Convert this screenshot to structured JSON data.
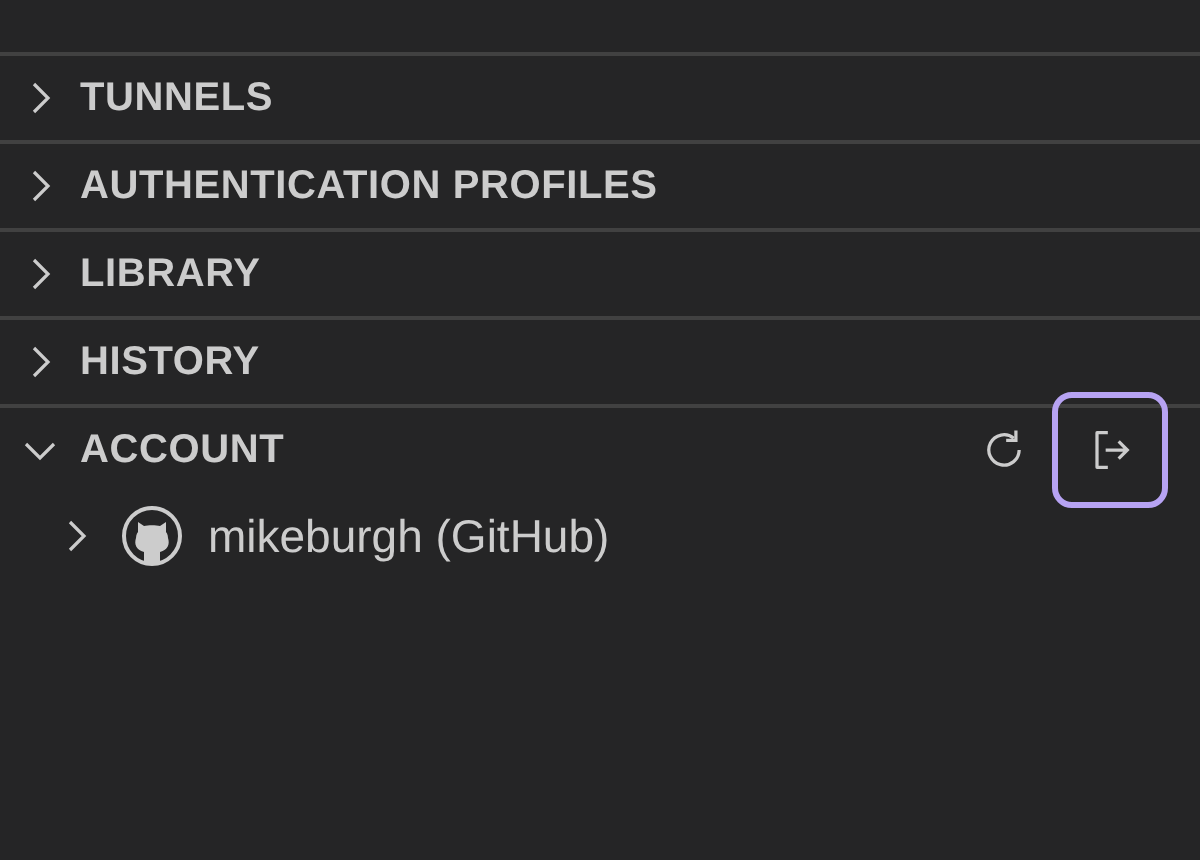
{
  "sections": [
    {
      "title": "TUNNELS",
      "expanded": false
    },
    {
      "title": "AUTHENTICATION PROFILES",
      "expanded": false
    },
    {
      "title": "LIBRARY",
      "expanded": false
    },
    {
      "title": "HISTORY",
      "expanded": false
    },
    {
      "title": "ACCOUNT",
      "expanded": true,
      "actions": [
        {
          "kind": "refresh",
          "focused": false
        },
        {
          "kind": "sign-out",
          "focused": true
        }
      ],
      "items": [
        {
          "label": "mikeburgh (GitHub)",
          "kind": "github",
          "expanded": false
        }
      ]
    }
  ]
}
